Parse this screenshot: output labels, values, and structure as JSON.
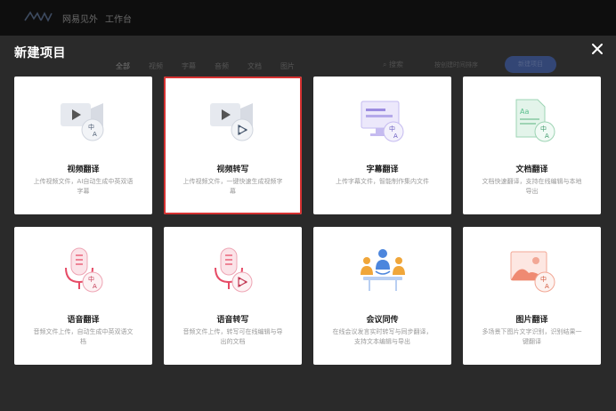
{
  "app": {
    "title": "网易见外",
    "workspace": "工作台"
  },
  "background": {
    "tabs": [
      "全部",
      "视频",
      "字幕",
      "音频",
      "文档",
      "图片"
    ],
    "search_label": "搜索",
    "sort_label": "按创建时间排序",
    "new_button": "新建项目"
  },
  "modal": {
    "title": "新建项目",
    "close_icon": "close-icon"
  },
  "cards": [
    {
      "title": "视频翻译",
      "desc": "上传视频文件，AI自动生成中英双语字幕",
      "icon": "video-translate-icon",
      "selected": false
    },
    {
      "title": "视频转写",
      "desc": "上传视频文件，一键快速生成视频字幕",
      "icon": "video-transcribe-icon",
      "selected": true
    },
    {
      "title": "字幕翻译",
      "desc": "上传字幕文件，智能制作集内文件",
      "icon": "subtitle-translate-icon",
      "selected": false
    },
    {
      "title": "文档翻译",
      "desc": "文档快速翻译，支持在线编辑与本地导出",
      "icon": "document-translate-icon",
      "selected": false
    },
    {
      "title": "语音翻译",
      "desc": "音频文件上传，自动生成中英双语文档",
      "icon": "audio-translate-icon",
      "selected": false
    },
    {
      "title": "语音转写",
      "desc": "音频文件上传，转写可在线编辑与导出的文档",
      "icon": "audio-transcribe-icon",
      "selected": false
    },
    {
      "title": "会议同传",
      "desc": "在线会议发言实时转写与同步翻译，支持文本编辑与导出",
      "icon": "meeting-interpret-icon",
      "selected": false
    },
    {
      "title": "图片翻译",
      "desc": "多场景下图片文字识别，识别结果一键翻译",
      "icon": "image-translate-icon",
      "selected": false
    }
  ],
  "colors": {
    "selected_border": "#d63232",
    "teal_badge": "#eaf2ff",
    "pink_accent": "#e64b66",
    "purple_accent": "#9c8ce0",
    "green_accent": "#5bbf8d",
    "blue_accent": "#4c86dd"
  }
}
